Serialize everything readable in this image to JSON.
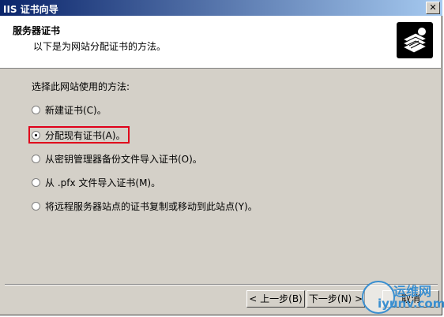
{
  "window": {
    "title": "IIS 证书向导",
    "close_symbol": "✕"
  },
  "header": {
    "title": "服务器证书",
    "subtitle": "以下是为网站分配证书的方法。",
    "icon": "certificate-stack-icon"
  },
  "body": {
    "prompt": "选择此网站使用的方法:",
    "options": [
      {
        "label": "新建证书(C)。",
        "checked": false
      },
      {
        "label": "分配现有证书(A)。",
        "checked": true
      },
      {
        "label": "从密钥管理器备份文件导入证书(O)。",
        "checked": false
      },
      {
        "label": "从 .pfx 文件导入证书(M)。",
        "checked": false
      },
      {
        "label": "将远程服务器站点的证书复制或移动到此站点(Y)。",
        "checked": false
      }
    ]
  },
  "buttons": {
    "back": "< 上一步(B)",
    "next": "下一步(N) >",
    "cancel": "取消"
  },
  "watermark": {
    "cn": "运维网",
    "en": "iyunv.com"
  },
  "colors": {
    "title_start": "#0a246a",
    "title_end": "#a6caf0",
    "highlight": "#e0001a",
    "watermark": "#3a8fd0"
  }
}
